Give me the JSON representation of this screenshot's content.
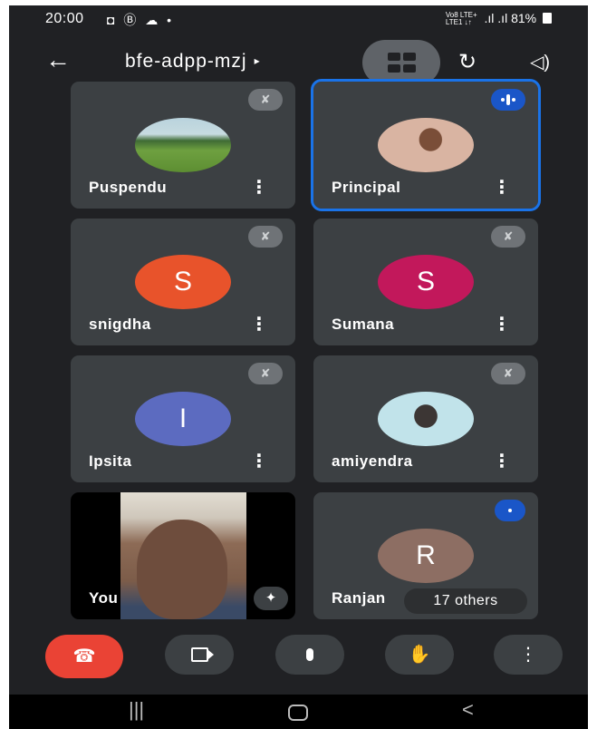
{
  "status_bar": {
    "time": "20:00",
    "left_icons": "◘ Ⓑ ☁ •",
    "network": "Vo8 LTE+\nLTE1 ↓↑",
    "signal": ".ıl .ıl",
    "battery": "81%"
  },
  "topbar": {
    "back_icon": "←",
    "meeting_code": "bfe-adpp-mzj",
    "caret": "▸",
    "flip_camera_icon": "↻",
    "speaker_icon": "◁)"
  },
  "tiles": [
    {
      "name": "Puspendu",
      "menu": "⋮",
      "muted_icon": "✘"
    },
    {
      "name": "Principal",
      "menu": "⋮"
    },
    {
      "name": "snigdha",
      "initial": "S",
      "menu": "⋮",
      "muted_icon": "✘",
      "color": "#e8532b"
    },
    {
      "name": "Sumana",
      "initial": "S",
      "menu": "⋮",
      "muted_icon": "✘",
      "color": "#c2185b"
    },
    {
      "name": "Ipsita",
      "initial": "I",
      "menu": "⋮",
      "muted_icon": "✘",
      "color": "#5c6bc0"
    },
    {
      "name": "amiyendra",
      "menu": "⋮",
      "muted_icon": "✘"
    },
    {
      "name": "You",
      "effects_icon": "✦"
    },
    {
      "name": "Ranjan",
      "initial": "R",
      "others": "17 others",
      "color": "#8d6e63"
    }
  ],
  "controls": {
    "end_call_icon": "☎",
    "hand_icon": "✋",
    "more_icon": "⋮"
  },
  "nav": {
    "recents": "|||",
    "back": "<"
  },
  "colors": {
    "background": "#202124",
    "tile": "#3c4043",
    "active_outline": "#1a73e8",
    "end_call": "#ea4335"
  }
}
